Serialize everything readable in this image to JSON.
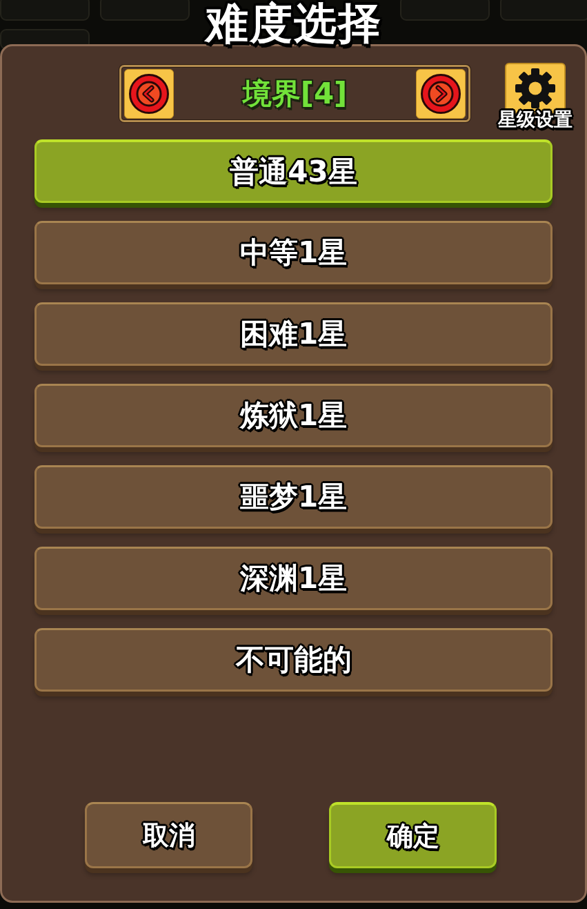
{
  "title": "难度选择",
  "realm_selector": {
    "label": "境界[4]"
  },
  "star_settings": {
    "label": "星级设置"
  },
  "difficulties": [
    {
      "label": "普通43星",
      "selected": true
    },
    {
      "label": "中等1星",
      "selected": false
    },
    {
      "label": "困难1星",
      "selected": false
    },
    {
      "label": "炼狱1星",
      "selected": false
    },
    {
      "label": "噩梦1星",
      "selected": false
    },
    {
      "label": "深渊1星",
      "selected": false
    },
    {
      "label": "不可能的",
      "selected": false
    }
  ],
  "buttons": [
    {
      "label": "取消",
      "kind": "cancel"
    },
    {
      "label": "确定",
      "kind": "confirm"
    }
  ]
}
